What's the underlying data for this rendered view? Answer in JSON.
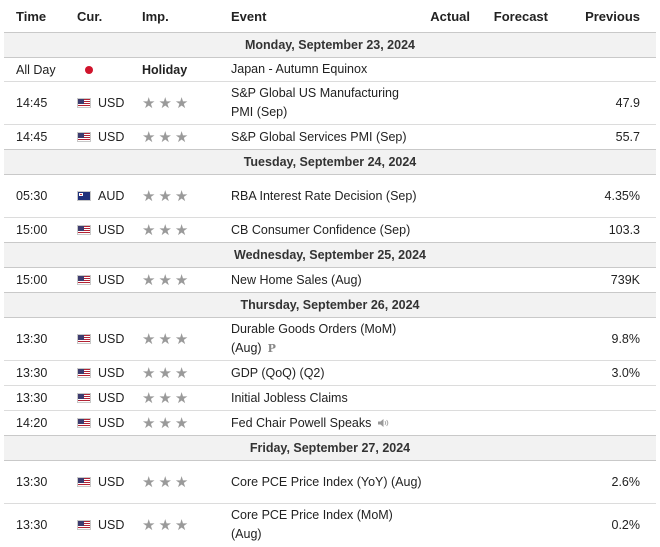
{
  "header": {
    "time": "Time",
    "currency": "Cur.",
    "importance": "Imp.",
    "event": "Event",
    "actual": "Actual",
    "forecast": "Forecast",
    "previous": "Previous"
  },
  "groups": [
    {
      "date": "Monday, September 23, 2024",
      "rows": [
        {
          "time": "All Day",
          "currency": "",
          "flag": "jp",
          "importance": "Holiday",
          "event": "Japan - Autumn Equinox",
          "actual": "",
          "forecast": "",
          "previous": ""
        },
        {
          "time": "14:45",
          "currency": "USD",
          "flag": "us",
          "importance": "",
          "event": "S&P Global US Manufacturing PMI (Sep)",
          "actual": "",
          "forecast": "",
          "previous": "47.9"
        },
        {
          "time": "14:45",
          "currency": "USD",
          "flag": "us",
          "importance": "",
          "event": "S&P Global Services PMI (Sep)",
          "actual": "",
          "forecast": "",
          "previous": "55.7"
        }
      ]
    },
    {
      "date": "Tuesday, September 24, 2024",
      "rows": [
        {
          "time": "05:30",
          "currency": "AUD",
          "flag": "au",
          "importance": "",
          "event": "RBA Interest Rate Decision (Sep)",
          "actual": "",
          "forecast": "",
          "previous": "4.35%"
        },
        {
          "time": "15:00",
          "currency": "USD",
          "flag": "us",
          "importance": "",
          "event": "CB Consumer Confidence (Sep)",
          "actual": "",
          "forecast": "",
          "previous": "103.3"
        }
      ]
    },
    {
      "date": "Wednesday, September 25, 2024",
      "rows": [
        {
          "time": "15:00",
          "currency": "USD",
          "flag": "us",
          "importance": "",
          "event": "New Home Sales (Aug)",
          "actual": "",
          "forecast": "",
          "previous": "739K"
        }
      ]
    },
    {
      "date": "Thursday, September 26, 2024",
      "rows": [
        {
          "time": "13:30",
          "currency": "USD",
          "flag": "us",
          "importance": "",
          "event": "Durable Goods Orders (MoM) (Aug)",
          "actual": "",
          "forecast": "",
          "previous": "9.8%",
          "marker": "P"
        },
        {
          "time": "13:30",
          "currency": "USD",
          "flag": "us",
          "importance": "",
          "event": "GDP (QoQ) (Q2)",
          "actual": "",
          "forecast": "",
          "previous": "3.0%"
        },
        {
          "time": "13:30",
          "currency": "USD",
          "flag": "us",
          "importance": "",
          "event": "Initial Jobless Claims",
          "actual": "",
          "forecast": "",
          "previous": ""
        },
        {
          "time": "14:20",
          "currency": "USD",
          "flag": "us",
          "importance": "",
          "event": "Fed Chair Powell Speaks",
          "actual": "",
          "forecast": "",
          "previous": "",
          "speaker": true
        }
      ]
    },
    {
      "date": "Friday, September 27, 2024",
      "rows": [
        {
          "time": "13:30",
          "currency": "USD",
          "flag": "us",
          "importance": "",
          "event": "Core PCE Price Index (YoY) (Aug)",
          "actual": "",
          "forecast": "",
          "previous": "2.6%"
        },
        {
          "time": "13:30",
          "currency": "USD",
          "flag": "us",
          "importance": "",
          "event": "Core PCE Price Index (MoM) (Aug)",
          "actual": "",
          "forecast": "",
          "previous": "0.2%"
        }
      ]
    }
  ]
}
